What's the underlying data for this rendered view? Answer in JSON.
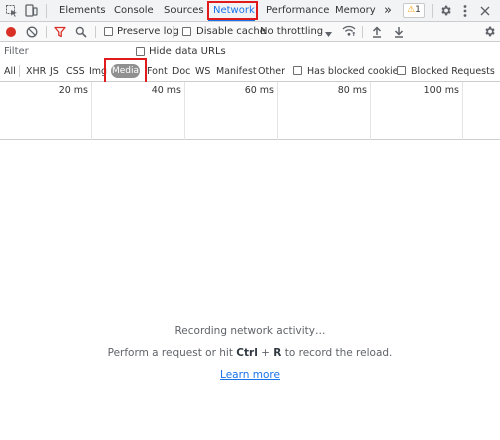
{
  "tabs": {
    "elements": "Elements",
    "console": "Console",
    "sources": "Sources",
    "network": "Network",
    "performance": "Performance",
    "memory": "Memory",
    "more": "»",
    "warning_count": "1"
  },
  "toolbar": {
    "preserve_log": "Preserve log",
    "disable_cache": "Disable cache",
    "throttling": "No throttling"
  },
  "filter": {
    "placeholder": "Filter",
    "hide_data_urls": "Hide data URLs",
    "types": [
      "All",
      "XHR",
      "JS",
      "CSS",
      "Img",
      "Media",
      "Font",
      "Doc",
      "WS",
      "Manifest",
      "Other"
    ],
    "selected_type": "Media",
    "has_blocked_cookies": "Has blocked cookies",
    "blocked_requests": "Blocked Requests"
  },
  "timeline": {
    "ticks": [
      "20 ms",
      "40 ms",
      "60 ms",
      "80 ms",
      "100 ms"
    ]
  },
  "empty_state": {
    "recording": "Recording network activity…",
    "hint_prefix": "Perform a request or hit ",
    "shortcut_ctrl": "Ctrl",
    "shortcut_plus": " + ",
    "shortcut_key": "R",
    "hint_suffix": " to record the reload.",
    "learn_more": "Learn more"
  },
  "colors": {
    "accent": "#1a73e8",
    "record": "#d93025",
    "filter_funnel": "#d93025",
    "highlight": "#e01b1b",
    "warning": "#f29900"
  }
}
